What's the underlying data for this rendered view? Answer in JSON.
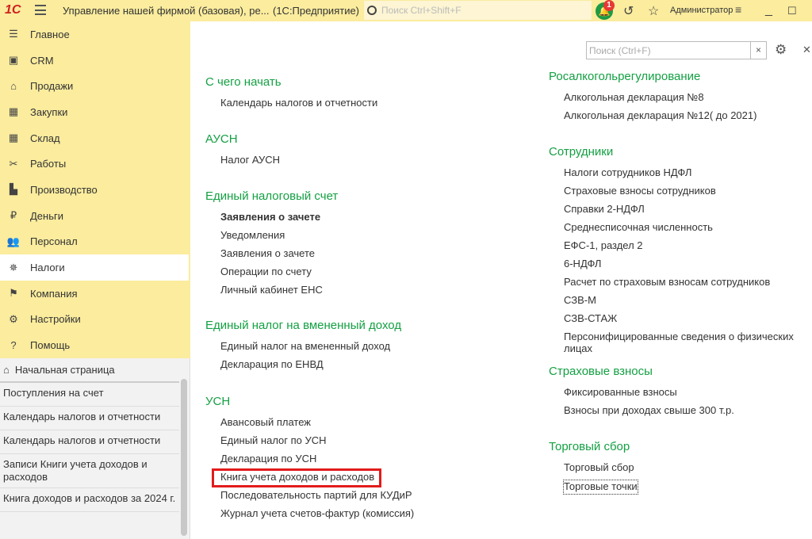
{
  "header": {
    "logo": "1С",
    "title": "Управление нашей фирмой (базовая), ре...",
    "platform": "(1С:Предприятие)",
    "search_placeholder": "Поиск Ctrl+Shift+F",
    "notifications": "1",
    "user": "Администратор"
  },
  "sidebar": {
    "items": [
      {
        "label": "Главное",
        "icon": "list-icon"
      },
      {
        "label": "CRM",
        "icon": "contact-card-icon"
      },
      {
        "label": "Продажи",
        "icon": "basket-icon"
      },
      {
        "label": "Закупки",
        "icon": "cart-icon"
      },
      {
        "label": "Склад",
        "icon": "warehouse-icon"
      },
      {
        "label": "Работы",
        "icon": "tools-icon"
      },
      {
        "label": "Производство",
        "icon": "factory-icon"
      },
      {
        "label": "Деньги",
        "icon": "ruble-icon"
      },
      {
        "label": "Персонал",
        "icon": "people-icon"
      },
      {
        "label": "Налоги",
        "icon": "eagle-icon",
        "active": true
      },
      {
        "label": "Компания",
        "icon": "flag-icon"
      },
      {
        "label": "Настройки",
        "icon": "gear-icon"
      },
      {
        "label": "Помощь",
        "icon": "help-icon"
      }
    ]
  },
  "open_windows": {
    "home": "Начальная страница",
    "items": [
      "Поступления на счет",
      "Календарь налогов и отчетности",
      "Календарь налогов и отчетности",
      "Записи Книги учета доходов и расходов",
      "Книга доходов и расходов за 2024 г."
    ]
  },
  "main": {
    "search_placeholder": "Поиск (Ctrl+F)",
    "left": [
      {
        "title": "С чего начать",
        "items": [
          "Календарь налогов и отчетности"
        ]
      },
      {
        "title": "АУСН",
        "items": [
          "Налог АУСН"
        ]
      },
      {
        "title": "Единый налоговый счет",
        "items": [
          "Заявления о зачете",
          "Уведомления",
          "Заявления о зачете",
          "Операции по счету",
          "Личный кабинет ЕНС"
        ]
      },
      {
        "title": "Единый налог на вмененный доход",
        "items": [
          "Единый налог на вмененный доход",
          "Декларация по ЕНВД"
        ]
      },
      {
        "title": "УСН",
        "items": [
          "Авансовый платеж",
          "Единый налог по УСН",
          "Декларация по УСН",
          "Книга учета доходов и расходов",
          "Последовательность партий для КУДиР",
          "Журнал учета счетов-фактур (комиссия)"
        ]
      }
    ],
    "right": [
      {
        "title": "Росалкогольрегулирование",
        "items": [
          "Алкогольная декларация №8",
          "Алкогольная декларация №12( до 2021)"
        ]
      },
      {
        "title": "Сотрудники",
        "items": [
          "Налоги сотрудников НДФЛ",
          "Страховые взносы сотрудников",
          "Справки 2-НДФЛ",
          "Среднесписочная численность",
          "ЕФС-1, раздел 2",
          "6-НДФЛ",
          "Расчет по страховым взносам сотрудников",
          "СЗВ-М",
          "СЗВ-СТАЖ",
          "Персонифицированные сведения о физических лицах"
        ]
      },
      {
        "title": "Страховые взносы",
        "items": [
          "Фиксированные взносы",
          "Взносы при доходах свыше 300 т.р."
        ]
      },
      {
        "title": "Торговый сбор",
        "items": [
          "Торговый сбор",
          "Торговые точки"
        ]
      }
    ]
  }
}
